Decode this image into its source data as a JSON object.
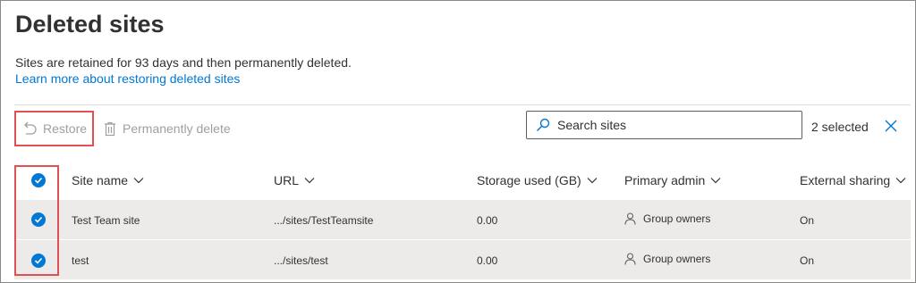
{
  "page": {
    "title": "Deleted sites",
    "description": "Sites are retained for 93 days and then permanently deleted.",
    "learn_more_link": "Learn more about restoring deleted sites"
  },
  "toolbar": {
    "restore_label": "Restore",
    "permanently_delete_label": "Permanently delete",
    "search_placeholder": "Search sites",
    "selected_count": "2 selected"
  },
  "table": {
    "columns": {
      "site_name": "Site name",
      "url": "URL",
      "storage": "Storage used (GB)",
      "primary_admin": "Primary admin",
      "external_sharing": "External sharing"
    },
    "rows": [
      {
        "site_name": "Test Team site",
        "url": ".../sites/TestTeamsite",
        "storage": "0.00",
        "primary_admin": "Group owners",
        "external_sharing": "On",
        "selected": true
      },
      {
        "site_name": "test",
        "url": ".../sites/test",
        "storage": "0.00",
        "primary_admin": "Group owners",
        "external_sharing": "On",
        "selected": true
      }
    ]
  },
  "colors": {
    "accent": "#0078d4",
    "highlight_box": "#e15151",
    "selected_row": "#edebe9"
  }
}
